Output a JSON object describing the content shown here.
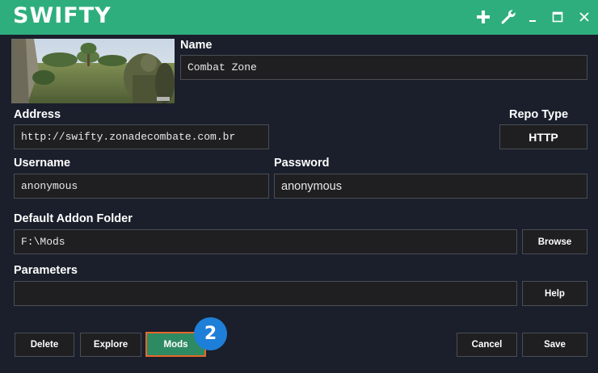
{
  "app": {
    "title": "SWIFTY"
  },
  "titlebar": {
    "icons": [
      "plus-icon",
      "wrench-icon",
      "minimize-icon",
      "maximize-icon",
      "close-icon"
    ],
    "accent": "#2fae7d"
  },
  "form": {
    "name_label": "Name",
    "name_value": "Combat Zone",
    "address_label": "Address",
    "address_value": "http://swifty.zonadecombate.com.br",
    "repo_type_label": "Repo Type",
    "repo_type_value": "HTTP",
    "username_label": "Username",
    "username_value": "anonymous",
    "password_label": "Password",
    "password_value": "anonymous",
    "addon_folder_label": "Default Addon Folder",
    "addon_folder_value": "F:\\Mods",
    "parameters_label": "Parameters",
    "parameters_value": ""
  },
  "buttons": {
    "browse": "Browse",
    "help": "Help",
    "delete": "Delete",
    "explore": "Explore",
    "mods": "Mods",
    "cancel": "Cancel",
    "save": "Save"
  },
  "annotation": {
    "step": "2",
    "color": "#1e7fd8",
    "highlight": "#e8672a"
  }
}
